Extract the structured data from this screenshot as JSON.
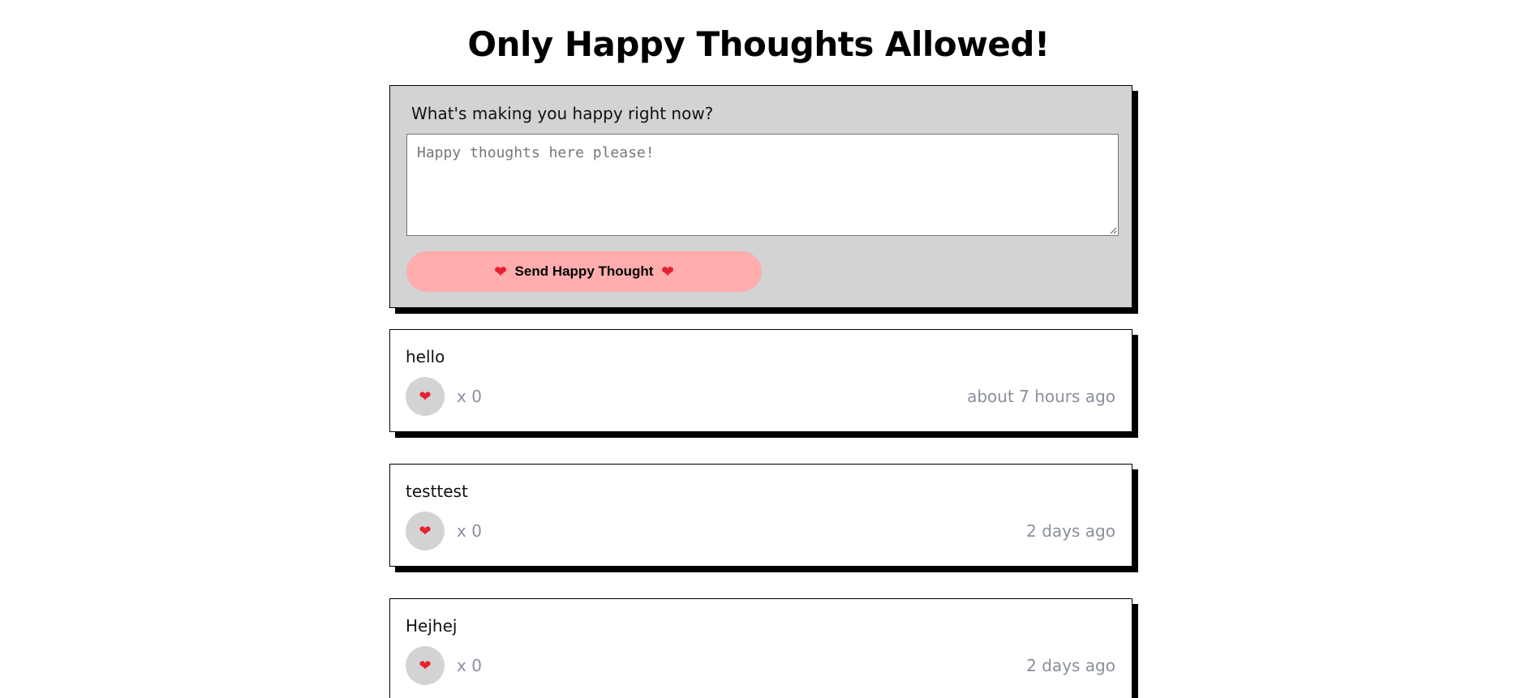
{
  "header": {
    "title": "Only Happy Thoughts Allowed!"
  },
  "form": {
    "label": "What's making you happy right now?",
    "placeholder": "Happy thoughts here please!",
    "value": "",
    "send_label": "Send Happy Thought"
  },
  "thoughts": [
    {
      "message": "hello",
      "likes": "x 0",
      "time": "about 7 hours ago"
    },
    {
      "message": "testtest",
      "likes": "x 0",
      "time": "2 days ago"
    },
    {
      "message": "Hejhej",
      "likes": "x 0",
      "time": "2 days ago"
    }
  ],
  "icons": {
    "heart": "heart-icon"
  },
  "colors": {
    "form_background": "#d3d3d3",
    "button_background": "#ffadad",
    "like_button_background": "#d3d3d3",
    "heart": "#e8212e",
    "muted_text": "#8a8f9c",
    "shadow": "#000000"
  }
}
